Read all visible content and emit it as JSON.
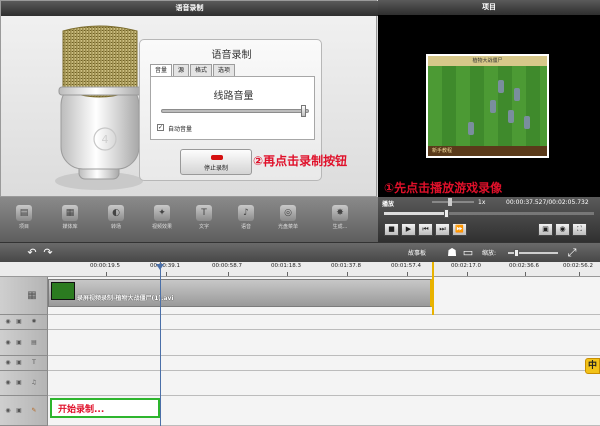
{
  "recorder": {
    "title": "语音录制",
    "settings_title": "语音录制",
    "tabs": [
      "音量",
      "源",
      "格式",
      "选项"
    ],
    "level_label": "线路音量",
    "auto_volume_label": "自动音量",
    "stop_button_label": "停止录制",
    "level": 0.97
  },
  "preview": {
    "title": "项目",
    "game_top_text": "植物大战僵尸",
    "game_bottom_text": "新手教程"
  },
  "playback": {
    "state": "播放",
    "speed": "1x",
    "time_current": "00:00:37.527",
    "time_total": "00:02:05.732"
  },
  "toolbar": {
    "items": [
      "项目",
      "媒体库",
      "转场",
      "视频效果",
      "文字",
      "语音",
      "光盘菜单",
      "生成..."
    ]
  },
  "timeline": {
    "storyboard_label": "故事板",
    "zoom_label": "缩放:",
    "ticks": [
      "00:00:19.5",
      "00:00:39.1",
      "00:00:58.7",
      "00:01:18.3",
      "00:01:37.8",
      "00:01:57.4",
      "00:02:17.0",
      "00:02:36.6",
      "00:02:56.2"
    ],
    "video_clip_label": "录屏视频录制-植物大战僵尸(1).avi",
    "record_track_text": "开始录制..."
  },
  "annotations": {
    "step1": "①先点击播放游戏录像",
    "step2": "②再点击录制按钮"
  },
  "side_badge": "中",
  "colors": {
    "annotation": "#e0102a",
    "record_box": "#2db52d",
    "clip_end": "#e9b300"
  }
}
